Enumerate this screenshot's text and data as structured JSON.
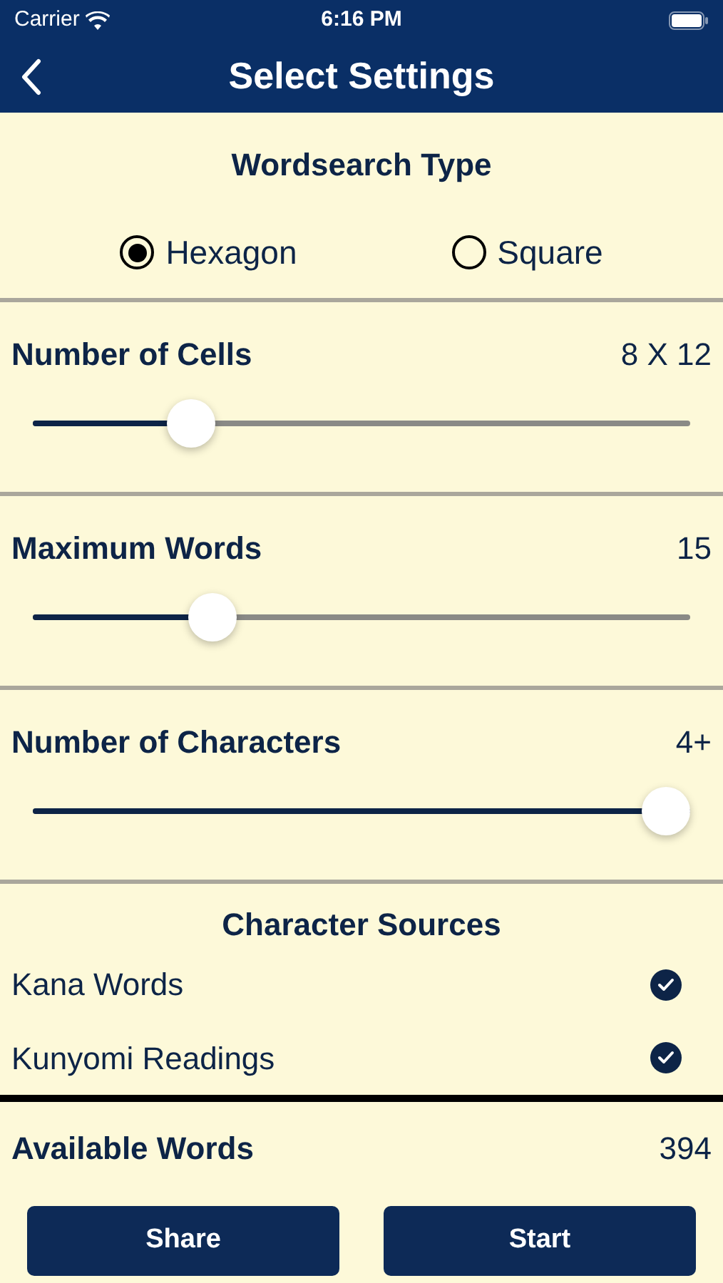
{
  "status_bar": {
    "carrier": "Carrier",
    "time": "6:16 PM"
  },
  "nav": {
    "title": "Select Settings"
  },
  "wordsearch_type": {
    "title": "Wordsearch Type",
    "options": [
      {
        "label": "Hexagon",
        "selected": true
      },
      {
        "label": "Square",
        "selected": false
      }
    ]
  },
  "sliders": [
    {
      "label": "Number of Cells",
      "value": "8 X 12",
      "level": 0.22
    },
    {
      "label": "Maximum Words",
      "value": "15",
      "level": 0.255
    },
    {
      "label": "Number of Characters",
      "value": "4+",
      "level": 1
    }
  ],
  "character_sources": {
    "title": "Character Sources",
    "items": [
      {
        "label": "Kana Words",
        "checked": true
      },
      {
        "label": "Kunyomi Readings",
        "checked": true
      }
    ]
  },
  "available_words": {
    "label": "Available Words",
    "value": "394"
  },
  "buttons": [
    "Share",
    "Start"
  ]
}
